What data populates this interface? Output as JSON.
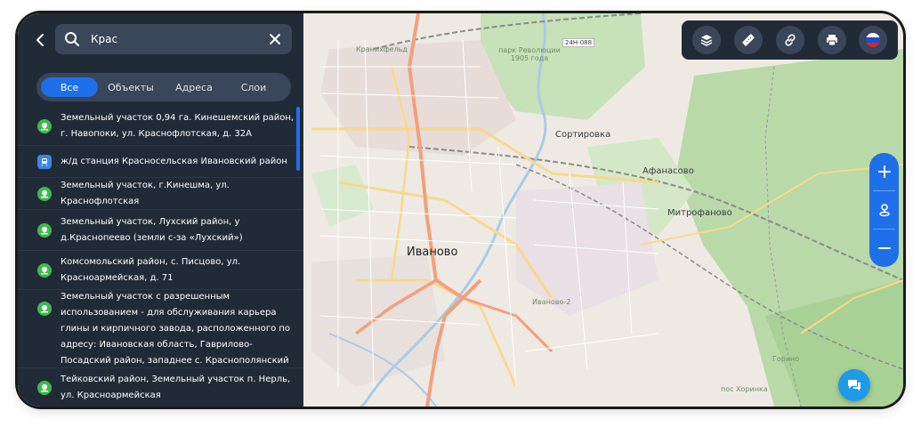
{
  "search": {
    "value": "Крас",
    "placeholder": ""
  },
  "tabs": [
    {
      "label": "Все",
      "active": true
    },
    {
      "label": "Объекты",
      "active": false
    },
    {
      "label": "Адреса",
      "active": false
    },
    {
      "label": "Слои",
      "active": false
    }
  ],
  "results": [
    {
      "text": "Земельный участок 0,94 га. Кинешемский район, г. Навопоки, ул. Краснофлотская, д. 32А",
      "icon": "land-parcel-icon"
    },
    {
      "text": "ж/д станция Красносельская Ивановский район",
      "icon": "railway-station-icon"
    },
    {
      "text": "Земельный участок, г.Кинешма, ул. Краснофлотская",
      "icon": "land-parcel-icon"
    },
    {
      "text": "Земельный участок, Лухский район, у д.Краснопеево (земли с-за «Лухский»)",
      "icon": "land-parcel-icon"
    },
    {
      "text": "Комсомольский район, с. Писцово, ул. Красноармейская, д. 71",
      "icon": "land-parcel-icon"
    },
    {
      "text": "Земельный участок с разрешенным использованием - для обслуживания карьера глины и кирпичного завода, расположенного по адресу: Ивановская область, Гаврилово-Посадский район, западнее с. Краснополянский",
      "icon": "land-parcel-icon"
    },
    {
      "text": "Тейковский район, Земельный участок п. Нерль, ул. Красноармейская",
      "icon": "land-parcel-icon"
    }
  ],
  "map": {
    "labels": {
      "ivanovo": "Иваново",
      "sortirovka": "Сортировка",
      "afanasovo": "Афанасово",
      "mitrofanovo": "Митрофаново",
      "park": "парк Революции 1905 года",
      "road": "24Н-088",
      "kranikhfeld": "Кранихфельд",
      "pos_gribuh": "Горино",
      "iv2": "Иваново-2",
      "khorinka": "пос Хоринка"
    },
    "colors": {
      "background": "#eeeae3",
      "forest": "#b9d9a8",
      "major_road": "#f2a07b",
      "secondary_road": "#f7d98a",
      "river": "#a9cbe8"
    }
  },
  "toolbar": {
    "buttons": [
      "layers-icon",
      "ruler-icon",
      "link-icon",
      "print-icon",
      "language-flag-icon"
    ]
  },
  "zoom": {
    "in_icon": "zoom-in-icon",
    "locate_icon": "my-location-icon",
    "out_icon": "zoom-out-icon"
  },
  "panel_colors": {
    "background": "#212b38",
    "accent": "#1f6fe8",
    "green": "#3fb94f"
  }
}
